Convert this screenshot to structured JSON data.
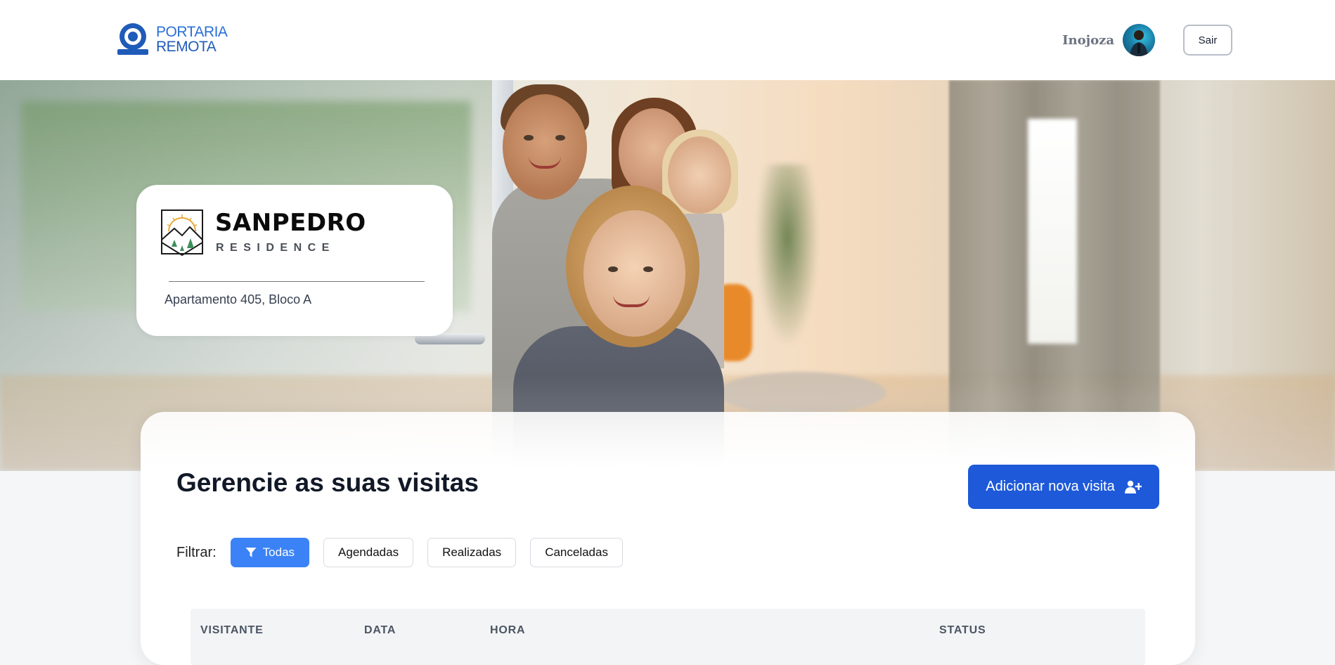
{
  "header": {
    "brand_line1": "PORTARIA",
    "brand_line2": "REMOTA",
    "user_name": "Inojoza",
    "logout_label": "Sair"
  },
  "property": {
    "name": "SANPEDRO",
    "subtitle": "RESIDENCE",
    "address": "Apartamento 405, Bloco A"
  },
  "main": {
    "title": "Gerencie as suas visitas",
    "add_button_label": "Adicionar nova visita",
    "filter_label": "Filtrar:",
    "filters": [
      {
        "label": "Todas",
        "active": true
      },
      {
        "label": "Agendadas",
        "active": false
      },
      {
        "label": "Realizadas",
        "active": false
      },
      {
        "label": "Canceladas",
        "active": false
      }
    ],
    "table": {
      "columns": [
        "VISITANTE",
        "DATA",
        "HORA",
        "STATUS"
      ]
    }
  },
  "colors": {
    "primary": "#1d59d9",
    "filter_active": "#3b82f6",
    "brand_blue": "#2a6fd6"
  },
  "icons": {
    "brand": "camera-lens-icon",
    "add_visit": "user-plus-icon",
    "filter": "filter-funnel-icon"
  }
}
